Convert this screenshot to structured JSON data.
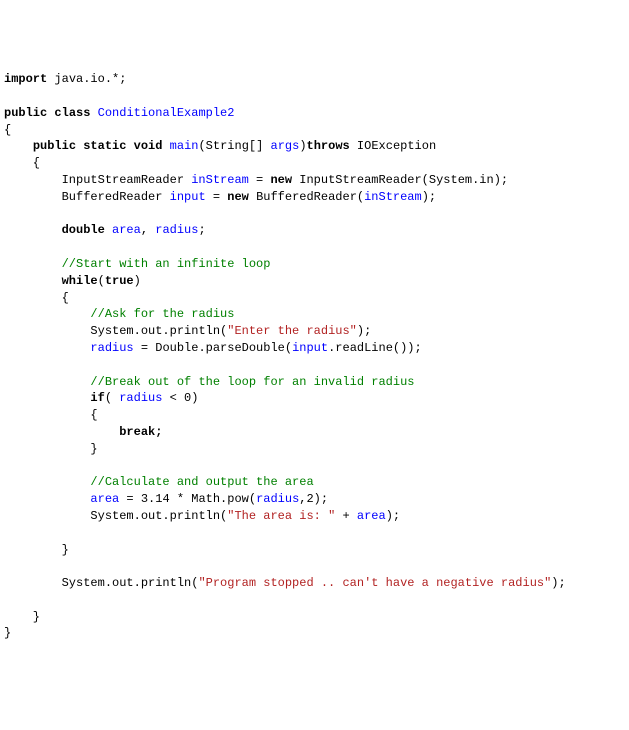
{
  "code": {
    "kw_import": "import",
    "io_pkg": " java.io.*;",
    "kw_public": "public",
    "kw_class": "class",
    "classname": "ConditionalExample2",
    "kw_static": "static",
    "kw_void": "void",
    "main": "main",
    "params_open": "(String[] ",
    "args": "args",
    "params_close": ")",
    "kw_throws": "throws",
    "ioexception": " IOException",
    "isr_decl": "InputStreamReader ",
    "inStream": "inStream",
    "eq_new": " = ",
    "kw_new": "new",
    "isr_ctor": " InputStreamReader(System.in);",
    "br_decl": "BufferedReader ",
    "input": "input",
    "br_ctor": " BufferedReader(",
    "br_ctor2": ");",
    "kw_double": "double",
    "area": "area",
    "comma": ", ",
    "radius": "radius",
    "semi": ";",
    "comment1": "//Start with an infinite loop",
    "kw_while": "while",
    "kw_true": "true",
    "paren_open": "(",
    "paren_close": ")",
    "comment2": "//Ask for the radius",
    "sysout": "System.out.println(",
    "str_enter": "\"Enter the radius\"",
    "close_stmt": ");",
    "radius_assign": " = Double.parseDouble(",
    "readline": ".readLine());",
    "comment3": "//Break out of the loop for an invalid radius",
    "kw_if": "if",
    "if_cond_open": "( ",
    "if_cond_close": " < 0)",
    "kw_break": "break;",
    "comment4": "//Calculate and output the area",
    "area_calc": " = 3.14 * Math.pow(",
    "area_calc2": ",2);",
    "str_area": "\"The area is: \"",
    "plus_area": " + ",
    "str_stopped": "\"Program stopped .. can't have a negative radius\""
  }
}
